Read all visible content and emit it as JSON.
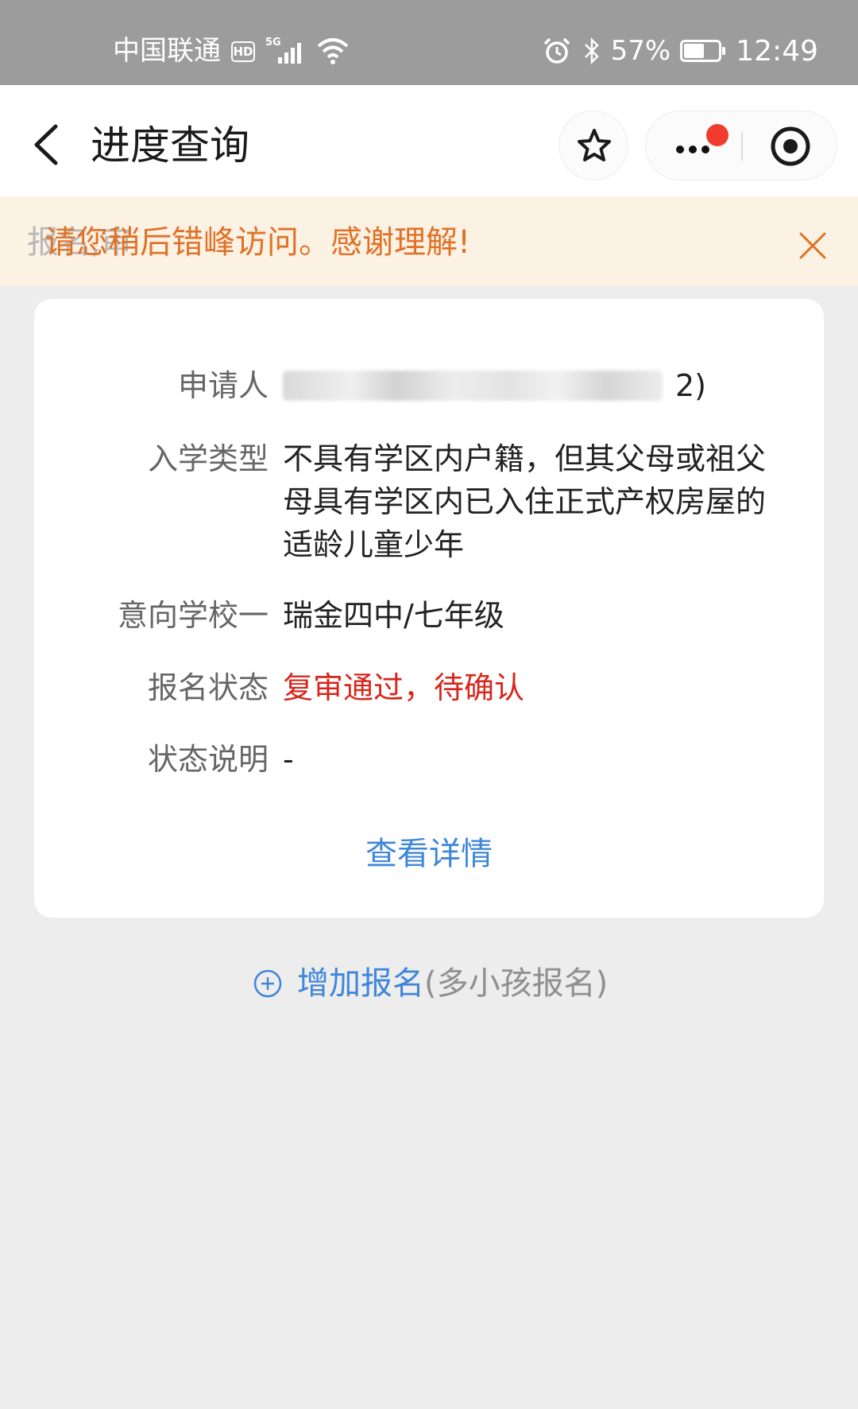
{
  "status_bar": {
    "carrier": "中国联通",
    "hd": "HD",
    "network": "5G",
    "battery_percent": "57%",
    "battery_level": 0.57,
    "time": "12:49"
  },
  "header": {
    "title": "进度查询"
  },
  "notice": {
    "ghost_text": "报名,审",
    "text": "请您稍后错峰访问。感谢理解!"
  },
  "card": {
    "rows": {
      "applicant": {
        "label": "申请人",
        "value_tail": "2)"
      },
      "admission_type": {
        "label": "入学类型",
        "value": "不具有学区内户籍，但其父母或祖父母具有学区内已入住正式产权房屋的适龄儿童少年"
      },
      "school": {
        "label": "意向学校一",
        "value": "瑞金四中/七年级"
      },
      "status": {
        "label": "报名状态",
        "value": "复审通过，待确认"
      },
      "description": {
        "label": "状态说明",
        "value": "-"
      }
    },
    "detail_link": "查看详情"
  },
  "add": {
    "label": "增加报名",
    "note": "(多小孩报名)"
  },
  "colors": {
    "accent_blue": "#3f86d8",
    "status_red": "#d7261c",
    "notice_orange": "#e07228",
    "notice_bg": "#fcf2e4"
  },
  "icons": [
    "back-arrow-icon",
    "star-icon",
    "more-dots-icon",
    "target-icon",
    "close-icon",
    "plus-circle-icon",
    "alarm-icon",
    "bluetooth-icon",
    "wifi-icon",
    "signal-icon",
    "battery-icon"
  ]
}
